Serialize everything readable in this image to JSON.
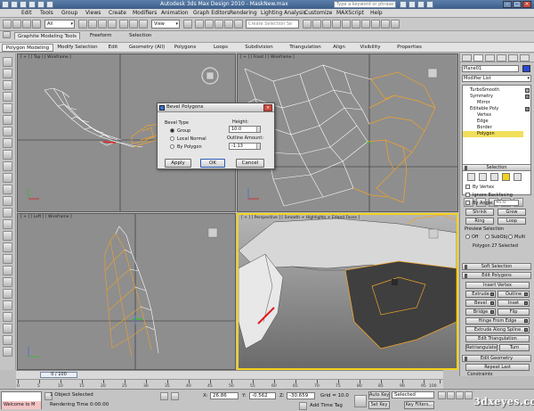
{
  "window": {
    "title": "Autodesk 3ds Max Design 2010 - MaskNew.max",
    "search_placeholder": "Type a keyword or phrase"
  },
  "menu": [
    "Edit",
    "Tools",
    "Group",
    "Views",
    "Create",
    "Modifiers",
    "Animation",
    "Graph Editors",
    "Rendering",
    "Lighting Analysis",
    "Customize",
    "MAXScript",
    "Help"
  ],
  "toolbar": {
    "filter_select": "All",
    "view_select": "View",
    "named_selection_placeholder": "Create Selection Se"
  },
  "ribbon": {
    "top_tabs": [
      "Graphite Modeling Tools",
      "Freeform",
      "Selection"
    ],
    "sub_tabs": [
      "Polygon Modeling",
      "Modify Selection",
      "Edit",
      "Geometry (All)",
      "Polygons",
      "Loops",
      "Subdivision",
      "Triangulation",
      "Align",
      "Visibility",
      "Properties"
    ],
    "active_sub_tab": "Polygon Modeling"
  },
  "viewports": {
    "top": "[ + ] [ Top ] [ Wireframe ]",
    "front": "[ + ] [ Front ] [ Wireframe ]",
    "left": "[ + ] [ Left ] [ Wireframe ]",
    "persp": "[ + ] [ Perspective ] [ Smooth + Highlights + Edged Faces ]"
  },
  "dialog": {
    "title": "Bevel Polygons",
    "bevel_type_label": "Bevel Type",
    "options": [
      "Group",
      "Local Normal",
      "By Polygon"
    ],
    "selected_option": "Group",
    "height_label": "Height:",
    "height_value": "10.0",
    "outline_label": "Outline Amount:",
    "outline_value": "-1.13",
    "apply_label": "Apply",
    "ok_label": "OK",
    "cancel_label": "Cancel"
  },
  "command_panel": {
    "object_name": "Plane01",
    "object_color": "#2b47d6",
    "modifier_list_label": "Modifier List",
    "stack": [
      "TurboSmooth",
      "Symmetry",
      "Mirror",
      "Editable Poly",
      "Vertex",
      "Edge",
      "Border",
      "Polygon"
    ],
    "selected_stack_item": "Polygon",
    "selection_rollout": "Selection",
    "by_vertex": "By Vertex",
    "ignore_backfacing": "Ignore Backfacing",
    "by_angle": "By Angle:",
    "by_angle_value": "45.0",
    "shrink": "Shrink",
    "grow": "Grow",
    "ring": "Ring",
    "loop": "Loop",
    "preview_selection": "Preview Selection",
    "preview_options": [
      "Off",
      "SubObj",
      "Multi"
    ],
    "selected_count": "Polygon 27 Selected",
    "soft_selection": "Soft Selection",
    "edit_polygons": "Edit Polygons",
    "insert_vertex": "Insert Vertex",
    "extrude": "Extrude",
    "outline": "Outline",
    "bevel": "Bevel",
    "inset": "Inset",
    "bridge": "Bridge",
    "flip": "Flip",
    "hinge_from_edge": "Hinge From Edge",
    "extrude_along_spline": "Extrude Along Spline",
    "edit_triangulation": "Edit Triangulation",
    "retriangulate": "Retriangulate",
    "turn": "Turn",
    "edit_geometry": "Edit Geometry",
    "repeat_last": "Repeat Last",
    "constraints": "Constraints"
  },
  "timeline": {
    "slider_label": "0 / 100",
    "ticks": [
      "0",
      "5",
      "10",
      "15",
      "20",
      "25",
      "30",
      "35",
      "40",
      "45",
      "50",
      "55",
      "60",
      "65",
      "70",
      "75",
      "80",
      "85",
      "90",
      "95",
      "100"
    ]
  },
  "status": {
    "maxscript_text": "Welcome to M",
    "selection_info": "1 Object Selected",
    "rendering_time": "Rendering Time  0:00:00",
    "x_label": "X:",
    "x_value": "26.86",
    "y_label": "Y:",
    "y_value": "-0.562",
    "z_label": "Z:",
    "z_value": "-30.659",
    "grid": "Grid = 10.0",
    "add_time_tag": "Add Time Tag",
    "auto_key": "Auto Key",
    "set_key": "Set Key",
    "selected": "Selected",
    "key_filters": "Key Filters..."
  },
  "watermark": "3dxeyes.com"
}
